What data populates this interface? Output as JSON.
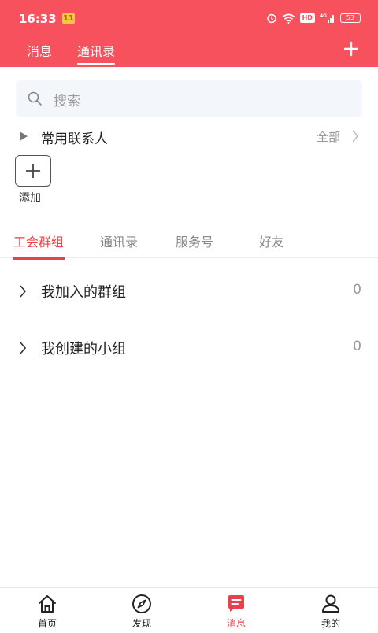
{
  "status_bar": {
    "time": "16:33",
    "notification_badge": "11",
    "hd_label": "HD",
    "network_label": "4G",
    "battery_level": "53"
  },
  "header": {
    "tabs": [
      {
        "label": "消息",
        "active": false
      },
      {
        "label": "通讯录",
        "active": true
      }
    ]
  },
  "search": {
    "placeholder": "搜索"
  },
  "contacts": {
    "title": "常用联系人",
    "all_label": "全部",
    "add_label": "添加"
  },
  "sub_tabs": [
    {
      "label": "工会群组",
      "active": true
    },
    {
      "label": "通讯录",
      "active": false
    },
    {
      "label": "服务号",
      "active": false
    },
    {
      "label": "好友",
      "active": false
    }
  ],
  "groups": [
    {
      "label": "我加入的群组",
      "count": "0"
    },
    {
      "label": "我创建的小组",
      "count": "0"
    }
  ],
  "bottom_nav": [
    {
      "label": "首页",
      "icon": "home-icon",
      "active": false
    },
    {
      "label": "发现",
      "icon": "compass-icon",
      "active": false
    },
    {
      "label": "消息",
      "icon": "message-icon",
      "active": true
    },
    {
      "label": "我的",
      "icon": "person-icon",
      "active": false
    }
  ],
  "colors": {
    "brand": "#f7515e",
    "accent": "#e9414b"
  }
}
